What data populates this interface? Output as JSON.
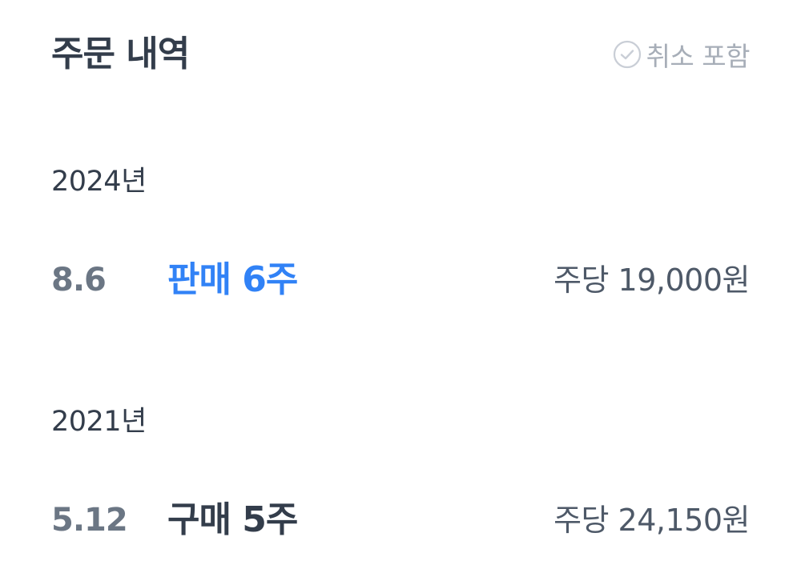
{
  "header": {
    "title": "주문 내역",
    "cancel_filter_label": "취소 포함",
    "cancel_filter_checked": false,
    "cancel_filter_icon": "check-circle-icon"
  },
  "groups": [
    {
      "year": "2024년",
      "orders": [
        {
          "date": "8.6",
          "type": "판매 6주",
          "kind": "sell",
          "price": "주당 19,000원"
        }
      ]
    },
    {
      "year": "2021년",
      "orders": [
        {
          "date": "5.12",
          "type": "구매 5주",
          "kind": "buy",
          "price": "주당 24,150원"
        }
      ]
    }
  ],
  "colors": {
    "title_text": "#333d4b",
    "sell_accent": "#3182f6",
    "muted": "#a7aeb8",
    "date_text": "#6b7684",
    "price_text": "#4e5968"
  }
}
